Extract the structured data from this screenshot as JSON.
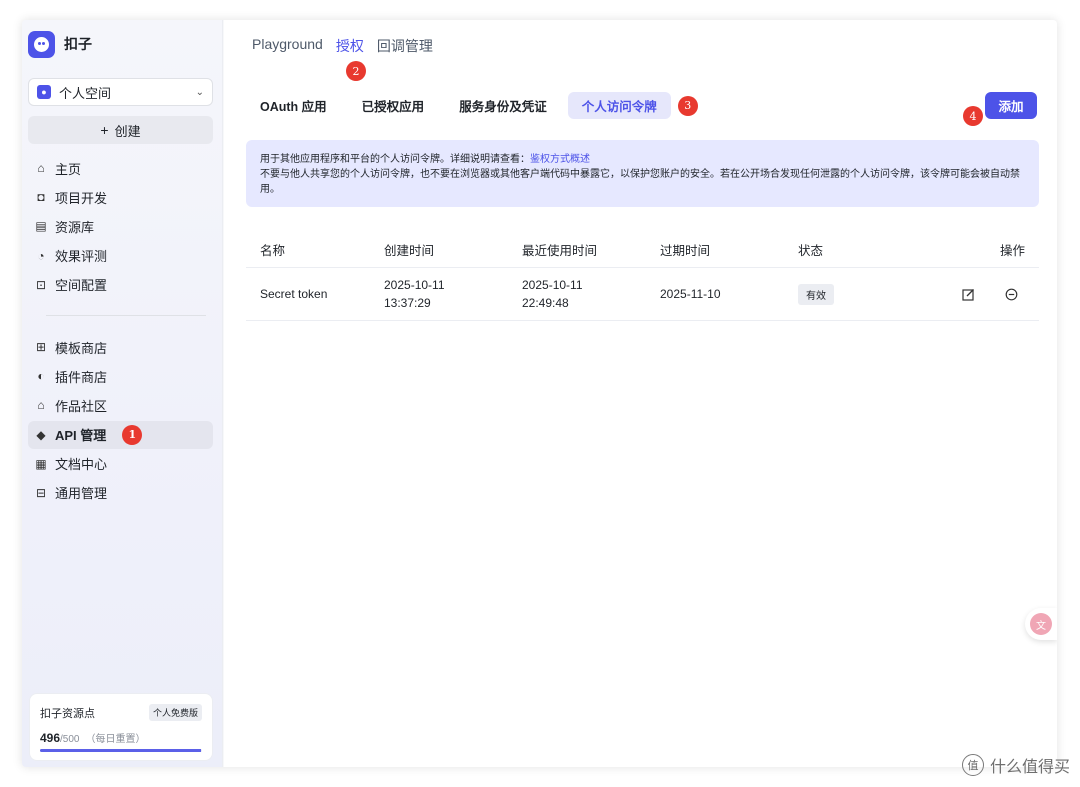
{
  "brand": {
    "name": "扣子"
  },
  "space": {
    "label": "个人空间"
  },
  "create": {
    "label": "创建"
  },
  "nav_primary": [
    {
      "label": "主页",
      "icon": "home-icon"
    },
    {
      "label": "项目开发",
      "icon": "project-icon"
    },
    {
      "label": "资源库",
      "icon": "library-icon"
    },
    {
      "label": "效果评测",
      "icon": "evaluation-icon"
    },
    {
      "label": "空间配置",
      "icon": "space-config-icon"
    }
  ],
  "nav_secondary": [
    {
      "label": "模板商店",
      "icon": "template-store-icon"
    },
    {
      "label": "插件商店",
      "icon": "plugin-store-icon"
    },
    {
      "label": "作品社区",
      "icon": "community-icon"
    },
    {
      "label": "API 管理",
      "icon": "api-icon",
      "active": true
    },
    {
      "label": "文档中心",
      "icon": "docs-icon"
    },
    {
      "label": "通用管理",
      "icon": "general-manage-icon"
    }
  ],
  "quota": {
    "title": "扣子资源点",
    "plan": "个人免费版",
    "used": "496",
    "total": "/500",
    "note": "（每日重置）",
    "fraction": 0.992
  },
  "top_tabs": [
    "Playground",
    "授权",
    "回调管理"
  ],
  "sub_tabs": [
    "OAuth 应用",
    "已授权应用",
    "服务身份及凭证",
    "个人访问令牌"
  ],
  "add_button": "添加",
  "info": {
    "line1": "用于其他应用程序和平台的个人访问令牌。详细说明请查看：",
    "link": "鉴权方式概述",
    "line2": "不要与他人共享您的个人访问令牌，也不要在浏览器或其他客户端代码中暴露它，以保护您账户的安全。若在公开场合发现任何泄露的个人访问令牌，该令牌可能会被自动禁用。"
  },
  "table": {
    "headers": [
      "名称",
      "创建时间",
      "最近使用时间",
      "过期时间",
      "状态",
      "操作"
    ],
    "rows": [
      {
        "name": "Secret token",
        "created_date": "2025-10-11",
        "created_time": "13:37:29",
        "last_used_date": "2025-10-11",
        "last_used_time": "22:49:48",
        "expires": "2025-11-10",
        "status": "有效"
      }
    ]
  },
  "markers": [
    "1",
    "2",
    "3",
    "4"
  ],
  "watermark": "什么值得买",
  "colors": {
    "accent": "#4d53e8",
    "marker": "#e8392f"
  }
}
